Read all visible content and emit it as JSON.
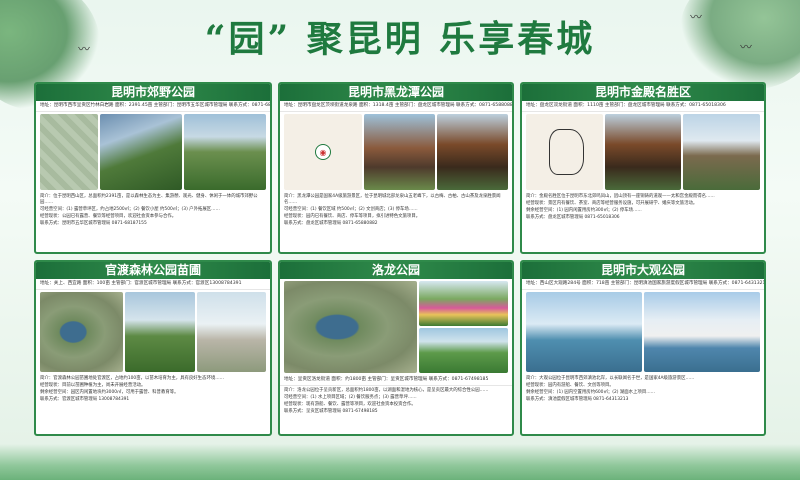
{
  "title": "“园” 聚昆明  乐享春城",
  "panels": [
    {
      "name": "昆明市郊野公园",
      "info": "地址：昆明市西市呈贡区竹林白岩路  面积：2391.45亩  主管部门：昆明市五华区城市管理局  联系方式：0871-68187155",
      "desc1": "简介：位于昆明西山区，总面积约2391亩，是以森林生态为主、集游憩、观光、健身、休闲于一体的城市郊野公园……",
      "desc2": "可经营空间：(1) 露营草坪区，约占地2500㎡；(2) 餐饮小屋 约500㎡；(3) 户外拓展区……",
      "desc3": "经营现状：公园已有露营、餐饮等经营项目，欢迎社会资本参与合作。",
      "desc4": "联系方式：昆明市五华区城市管理局 0871-68187155"
    },
    {
      "name": "昆明市黑龙潭公园",
      "info": "地址：昆明市盘龙区茨坝街道龙泉路  面积：1318.4亩  主管部门：盘龙区城市管理局  联系方式：0871-65880882",
      "desc1": "简介：黑龙潭公园是国家4A级旅游景区，位于昆明城北部龙泉山五老峰下，以古梅、古柏、古山茶及龙泉胜景闻名……",
      "desc2": "可经营空间：(1) 餐饮区域 约500㎡；(2) 文创商店；(3) 停车场……",
      "desc3": "经营现状：园内已有餐饮、商店、停车等项目，拟引进特色文旅项目。",
      "desc4": "联系方式：盘龙区城市管理局 0871-65880882"
    },
    {
      "name": "昆明市金殿名胜区",
      "info": "地址：盘龙区双龙街道  面积：1110亩  主管部门：盘龙区城市管理局  联系方式：0871-65018306",
      "desc1": "简介：金殿名胜区位于昆明市东北郊鸣凤山，因山顶有一座铜铸的道观——太和宫金殿而得名……",
      "desc2": "经营现状：景区内有餐饮、茶室、商店等经营服务设施，可开展研学、婚庆等文旅活动。",
      "desc3": "剩余经营空间：(1) 园内闲置用房约300㎡；(2) 停车场……",
      "desc4": "联系方式：盘龙区城市管理局 0871-65018306"
    },
    {
      "name": "官渡森林公园苗圃",
      "info": "地址：关上、西宜路  面积：100亩  主管部门：官渡区城市管理局  联系方式：官渡区13008784391",
      "desc1": "简介：官渡森林公园苗圃地处官渡区，占地约100亩，以苗木培育为主，具有良好生态环境……",
      "desc2": "经营现状：目前以苗圃种植为主，尚未开展经营活动。",
      "desc3": "剩余经营空间：园区内闲置地块约3000㎡，可用于露营、科普教育等。",
      "desc4": "联系方式：官渡区城市管理局 13008784391"
    },
    {
      "name": "洛龙公园",
      "info": "地址：呈贡区洛龙街道  面积：约1800亩  主管部门：呈贡区城市管理局  联系方式：0871-67498185",
      "desc1": "简介：洛龙公园位于呈贡新区，总面积约1800亩，以湖面和湿地为核心，是呈贡区最大的综合性公园……",
      "desc2": "可经营空间：(1) 水上项目区域；(2) 餐饮服务点；(3) 露营草坪……",
      "desc3": "经营现状：现有游船、餐饮、露营等项目，欢迎社会资本投资合作。",
      "desc4": "联系方式：呈贡区城市管理局 0871-67498185"
    },
    {
      "name": "昆明市大观公园",
      "info": "地址：西山区大观路284号  面积：718亩  主管部门：昆明滇池国家旅游度假区城市管理局  联系方式：0871-64313213",
      "desc1": "简介：大观公园位于昆明市西郊滇池北岸，以长联闻名于世，是国家4A级旅游景区……",
      "desc2": "经营现状：园内有游船、餐饮、文创等项目。",
      "desc3": "剩余经营空间：(1) 园内空置用房约600㎡；(2) 湖面水上项目……",
      "desc4": "联系方式：滇池度假区城市管理局 0871-64313213"
    }
  ]
}
